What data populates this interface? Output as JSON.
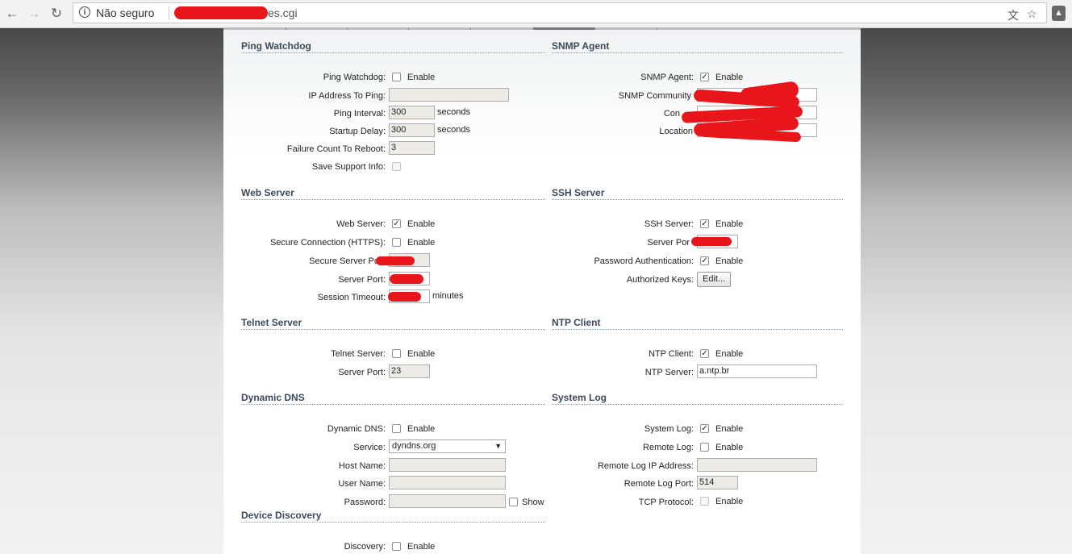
{
  "browser": {
    "security_text": "Não seguro",
    "url_host": "xxxxxxxxxxxxxxxx",
    "url_path": "es.cgi",
    "nav_icons": [
      "back-arrow-icon",
      "forward-arrow-icon",
      "reload-icon"
    ],
    "toolbar_icons": [
      "translate-icon",
      "star-icon",
      "extension-icon"
    ]
  },
  "common": {
    "enable_label": "Enable",
    "show_label": "Show"
  },
  "ping_watchdog": {
    "title": "Ping Watchdog",
    "ping_watchdog_label": "Ping Watchdog:",
    "ping_watchdog_checked": false,
    "ip_label": "IP Address To Ping:",
    "ip_value": "",
    "interval_label": "Ping Interval:",
    "interval_value": "300",
    "interval_unit": "seconds",
    "startup_label": "Startup Delay:",
    "startup_value": "300",
    "startup_unit": "seconds",
    "failure_label": "Failure Count To Reboot:",
    "failure_value": "3",
    "support_label": "Save Support Info:",
    "support_checked": false
  },
  "snmp_agent": {
    "title": "SNMP Agent",
    "agent_label": "SNMP Agent:",
    "agent_checked": true,
    "community_label": "SNMP Community",
    "contact_label": "Con",
    "location_label": "Location"
  },
  "web_server": {
    "title": "Web Server",
    "web_label": "Web Server:",
    "web_checked": true,
    "https_label": "Secure Connection (HTTPS):",
    "https_checked": false,
    "secure_port_label": "Secure Server Po",
    "port_label": "Server Port:",
    "timeout_label": "Session Timeout:",
    "timeout_unit": "minutes"
  },
  "ssh_server": {
    "title": "SSH Server",
    "ssh_label": "SSH Server:",
    "ssh_checked": true,
    "port_label": "Server Por",
    "password_label": "Password Authentication:",
    "password_checked": true,
    "keys_label": "Authorized Keys:",
    "edit_button": "Edit..."
  },
  "telnet_server": {
    "title": "Telnet Server",
    "telnet_label": "Telnet Server:",
    "telnet_checked": false,
    "port_label": "Server Port:",
    "port_value": "23"
  },
  "ntp_client": {
    "title": "NTP Client",
    "client_label": "NTP Client:",
    "client_checked": true,
    "server_label": "NTP Server:",
    "server_value": "a.ntp.br"
  },
  "dynamic_dns": {
    "title": "Dynamic DNS",
    "ddns_label": "Dynamic DNS:",
    "ddns_checked": false,
    "service_label": "Service:",
    "service_value": "dyndns.org",
    "host_label": "Host Name:",
    "host_value": "",
    "user_label": "User Name:",
    "user_value": "",
    "password_label": "Password:",
    "password_value": "",
    "show_checked": false
  },
  "system_log": {
    "title": "System Log",
    "syslog_label": "System Log:",
    "syslog_checked": true,
    "remote_label": "Remote Log:",
    "remote_checked": false,
    "remote_ip_label": "Remote Log IP Address:",
    "remote_ip_value": "",
    "remote_port_label": "Remote Log Port:",
    "remote_port_value": "514",
    "tcp_label": "TCP Protocol:",
    "tcp_checked": false
  },
  "device_discovery": {
    "title": "Device Discovery",
    "discovery_label": "Discovery:",
    "discovery_checked": false
  },
  "colors": {
    "section_title": "#3c4a59",
    "redaction": "#e8151b",
    "input_fill": "#ecebe6"
  }
}
